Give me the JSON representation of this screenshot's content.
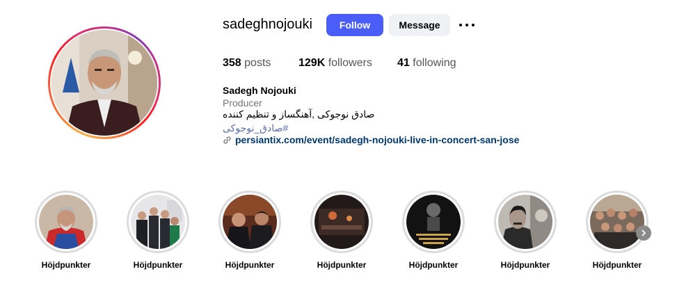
{
  "profile": {
    "username": "sadeghnojouki",
    "follow_label": "Follow",
    "message_label": "Message",
    "stats": {
      "posts_count": "358",
      "posts_label": "posts",
      "followers_count": "129K",
      "followers_label": "followers",
      "following_count": "41",
      "following_label": "following"
    },
    "full_name": "Sadegh Nojouki",
    "category": "Producer",
    "bio": "صادق نوجوکی ,آهنگساز و تنظیم کننده",
    "hashtag": "#صادق_نوجوکی",
    "link": "persiantix.com/event/sadegh-nojouki-live-in-concert-san-jose"
  },
  "highlights": [
    {
      "label": "Höjdpunkter"
    },
    {
      "label": "Höjdpunkter"
    },
    {
      "label": "Höjdpunkter"
    },
    {
      "label": "Höjdpunkter"
    },
    {
      "label": "Höjdpunkter"
    },
    {
      "label": "Höjdpunkter"
    },
    {
      "label": "Höjdpunkter"
    }
  ],
  "colors": {
    "follow_button": "#4a5df9",
    "message_button": "#eff1f4",
    "link": "#00376b",
    "hashtag": "#5a6fa8"
  },
  "icons": [
    "more-options-icon",
    "link-icon",
    "chevron-right-icon"
  ]
}
